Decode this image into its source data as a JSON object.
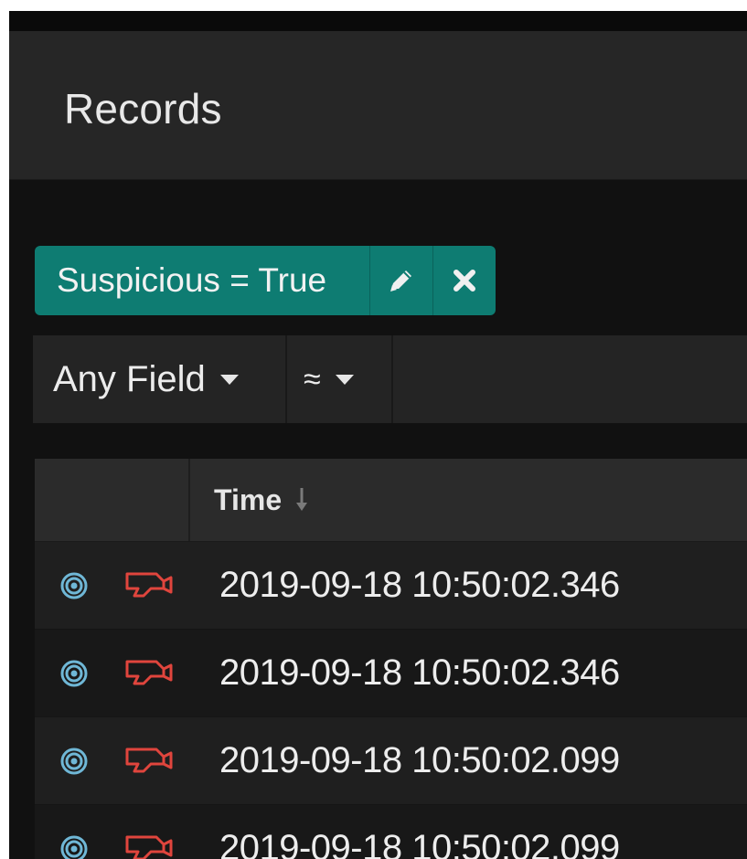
{
  "header": {
    "title": "Records"
  },
  "filter_chip": {
    "label": "Suspicious = True",
    "edit_icon": "pencil-icon",
    "remove_icon": "close-icon",
    "color": "#0e7c72"
  },
  "query_bar": {
    "field_select": "Any Field",
    "operator_select": "≈",
    "value": ""
  },
  "table": {
    "columns": [
      "",
      "Time"
    ],
    "sort": "descending",
    "rows": [
      {
        "time": "2019-09-18 10:50:02.346",
        "type_icon": "target-icon",
        "flag_icon": "camera-icon"
      },
      {
        "time": "2019-09-18 10:50:02.346",
        "type_icon": "target-icon",
        "flag_icon": "camera-icon"
      },
      {
        "time": "2019-09-18 10:50:02.099",
        "type_icon": "target-icon",
        "flag_icon": "camera-icon"
      },
      {
        "time": "2019-09-18 10:50:02.099",
        "type_icon": "target-icon",
        "flag_icon": "camera-icon"
      }
    ]
  },
  "colors": {
    "accent": "#0e7c72",
    "record_icon": "#6fb7d6",
    "suspicious_icon": "#e0453d"
  }
}
